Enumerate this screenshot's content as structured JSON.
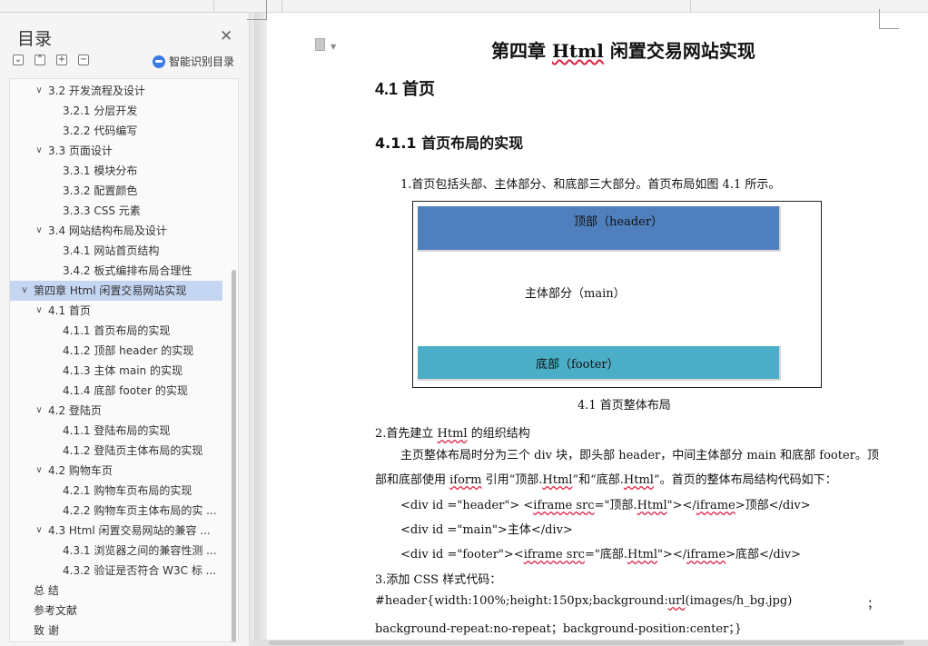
{
  "sidebar": {
    "title": "目录",
    "smart_label": "智能识别目录",
    "toc": [
      {
        "label": "3.2 开发流程及设计",
        "level": 2,
        "expanded": true
      },
      {
        "label": "3.2.1  分层开发",
        "level": 3
      },
      {
        "label": "3.2.2  代码编写",
        "level": 3
      },
      {
        "label": "3.3 页面设计",
        "level": 2,
        "expanded": true
      },
      {
        "label": "3.3.1 模块分布",
        "level": 3
      },
      {
        "label": "3.3.2  配置颜色",
        "level": 3
      },
      {
        "label": "3.3.3 CSS 元素",
        "level": 3
      },
      {
        "label": "3.4 网站结构布局及设计",
        "level": 2,
        "expanded": true
      },
      {
        "label": "3.4.1  网站首页结构",
        "level": 3
      },
      {
        "label": "3.4.2  板式编排布局合理性",
        "level": 3
      },
      {
        "label": "第四章  Html 闲置交易网站实现",
        "level": 1,
        "expanded": true,
        "active": true
      },
      {
        "label": "4.1 首页",
        "level": 2,
        "expanded": true
      },
      {
        "label": "4.1.1 首页布局的实现",
        "level": 3
      },
      {
        "label": "4.1.2  顶部 header 的实现",
        "level": 3
      },
      {
        "label": "4.1.3  主体 main 的实现",
        "level": 3
      },
      {
        "label": "4.1.4  底部 footer 的实现",
        "level": 3
      },
      {
        "label": "4.2  登陆页",
        "level": 2,
        "expanded": true
      },
      {
        "label": "4.1.1 登陆布局的实现",
        "level": 3
      },
      {
        "label": "4.1.2 登陆页主体布局的实现",
        "level": 3
      },
      {
        "label": "4.2  购物车页",
        "level": 2,
        "expanded": true
      },
      {
        "label": "4.2.1 购物车页布局的实现",
        "level": 3
      },
      {
        "label": "4.2.2 购物车页主体布局的实 ...",
        "level": 3
      },
      {
        "label": "4.3 Html 闲置交易网站的兼容 ...",
        "level": 2,
        "expanded": true
      },
      {
        "label": "4.3.1 浏览器之间的兼容性测 ...",
        "level": 3
      },
      {
        "label": "4.3.2 验证是否符合 W3C 标 ...",
        "level": 3
      },
      {
        "label": "总    结",
        "level": 1
      },
      {
        "label": "参考文献",
        "level": 1
      },
      {
        "label": "致    谢",
        "level": 1
      }
    ]
  },
  "document": {
    "chapter_title_pre": "第四章  ",
    "chapter_title_html": "Html",
    "chapter_title_post": " 闲置交易网站实现",
    "section_title": "4.1 首页",
    "subsection_title": "4.1.1 首页布局的实现",
    "p1": "1.首页包括头部、主体部分、和底部三大部分。首页布局如图 4.1 所示。",
    "fig_header": "顶部（header）",
    "fig_main": "主体部分（main）",
    "fig_footer": "底部（footer）",
    "fig_caption": "4.1 首页整体布局",
    "p2_pre": "2.首先建立 ",
    "p2_html": "Html",
    "p2_post": " 的组织结构",
    "p3_line1": "主页整体布局时分为三个 div 块，即头部 header，中间主体部分 main 和底部 footer。顶",
    "p3_line2_pre": "部和底部使用 ",
    "p3_line2_iform": "iform",
    "p3_line2_mid": " 引用“顶部.",
    "p3_line2_html1": "Html",
    "p3_line2_mid2": "”和“底部.",
    "p3_line2_html2": "Html",
    "p3_line2_post": "”。首页的整体布局结构代码如下：",
    "code1_a": "<div    id =\"header\"> <",
    "code1_b": "iframe src",
    "code1_c": "=\"顶部.",
    "code1_d": "Html",
    "code1_e": "\"></",
    "code1_f": "iframe",
    "code1_g": ">顶部</div>",
    "code2": "<div    id =\"main\">主体</div>",
    "code3_a": "<div    id =\"footer\"><",
    "code3_b": "iframe src",
    "code3_c": "=\"底部.",
    "code3_d": "Html",
    "code3_e": "\"></",
    "code3_f": "iframe",
    "code3_g": ">底部</div>",
    "p4": "3.添加 CSS 样式代码：",
    "css1_a": "#header{width:100%;height:150px;background:",
    "css1_b": "url",
    "css1_c": "(images/h_bg.jpg)",
    "css1_semicolon": "；",
    "css2": "background-repeat:no-repeat；background-position:center；}"
  }
}
